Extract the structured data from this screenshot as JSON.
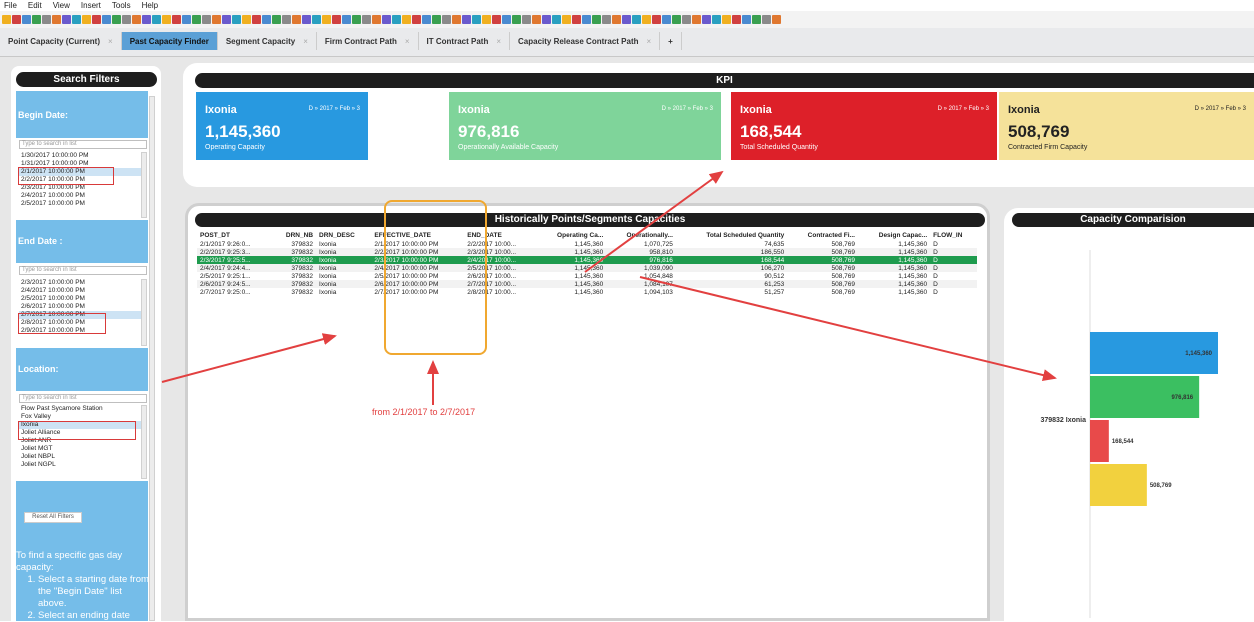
{
  "menu": [
    "File",
    "Edit",
    "View",
    "Insert",
    "Tools",
    "Help"
  ],
  "tabs": [
    {
      "label": "Point Capacity (Current)",
      "active": false
    },
    {
      "label": "Past Capacity Finder",
      "active": true
    },
    {
      "label": "Segment Capacity",
      "active": false
    },
    {
      "label": "Firm Contract Path",
      "active": false
    },
    {
      "label": "IT Contract Path",
      "active": false
    },
    {
      "label": "Capacity Release Contract Path",
      "active": false
    }
  ],
  "tab_close": "×",
  "tab_add": "+",
  "filters": {
    "title": "Search Filters",
    "begin_label": "Begin Date:",
    "end_label": "End Date :",
    "location_label": "Location:",
    "search_placeholder": "Type to search in list",
    "begin_list": [
      "1/30/2017 10:00:00 PM",
      "1/31/2017 10:00:00 PM",
      "2/1/2017 10:00:00 PM",
      "2/2/2017 10:00:00 PM",
      "2/3/2017 10:00:00 PM",
      "2/4/2017 10:00:00 PM",
      "2/5/2017 10:00:00 PM"
    ],
    "end_list": [
      "2/3/2017 10:00:00 PM",
      "2/4/2017 10:00:00 PM",
      "2/5/2017 10:00:00 PM",
      "2/6/2017 10:00:00 PM",
      "2/7/2017 10:00:00 PM",
      "2/8/2017 10:00:00 PM",
      "2/9/2017 10:00:00 PM"
    ],
    "location_list": [
      "Flow Past Sycamore Station",
      "Fox Valley",
      "Ixonia",
      "Joliet Alliance",
      "Joliet ANR",
      "Joliet MGT",
      "Joliet NBPL",
      "Joliet NGPL"
    ],
    "reset_label": "Reset All Filters",
    "instr_intro": "To find a specific gas day capacity:",
    "instr_steps": [
      "Select a starting date from the \"Begin Date\" list above.",
      "Select an ending date"
    ]
  },
  "kpi": {
    "title": "KPI",
    "cards": [
      {
        "loc": "Ixonia",
        "date": "D » 2017 » Feb » 3",
        "value": "1,145,360",
        "label": "Operating Capacity",
        "color": "#2899e0"
      },
      {
        "loc": "Ixonia",
        "date": "D » 2017 » Feb » 3",
        "value": "976,816",
        "label": "Operationally Available Capacity",
        "color": "#7fd49a"
      },
      {
        "loc": "Ixonia",
        "date": "D » 2017 » Feb » 3",
        "value": "168,544",
        "label": "Total Scheduled Quantity",
        "color": "#dd2029"
      },
      {
        "loc": "Ixonia",
        "date": "D » 2017 » Feb » 3",
        "value": "508,769",
        "label": "Contracted Firm Capacity",
        "color": "#f5e29a"
      }
    ]
  },
  "hist": {
    "title": "Historically Points/Segments Capacities",
    "columns": [
      "POST_DT",
      "DRN_NB",
      "DRN_DESC",
      "EFFECTIVE_DATE",
      "END_DATE",
      "Operating Ca...",
      "Operationally...",
      "Total Scheduled Quantity",
      "Contracted Fi...",
      "Design Capac...",
      "FLOW_IN"
    ],
    "rows": [
      [
        "2/1/2017 9:26:0...",
        "379832",
        "Ixonia",
        "2/1/2017 10:00:00 PM",
        "2/2/2017 10:00...",
        "1,145,360",
        "1,070,725",
        "74,635",
        "508,769",
        "1,145,360",
        "D"
      ],
      [
        "2/2/2017 9:25:3...",
        "379832",
        "Ixonia",
        "2/2/2017 10:00:00 PM",
        "2/3/2017 10:00...",
        "1,145,360",
        "958,810",
        "186,550",
        "508,769",
        "1,145,360",
        "D"
      ],
      [
        "2/3/2017 9:25:5...",
        "379832",
        "Ixonia",
        "2/3/2017 10:00:00 PM",
        "2/4/2017 10:00...",
        "1,145,360",
        "976,816",
        "168,544",
        "508,769",
        "1,145,360",
        "D"
      ],
      [
        "2/4/2017 9:24:4...",
        "379832",
        "Ixonia",
        "2/4/2017 10:00:00 PM",
        "2/5/2017 10:00...",
        "1,145,360",
        "1,039,090",
        "106,270",
        "508,769",
        "1,145,360",
        "D"
      ],
      [
        "2/5/2017 9:25:1...",
        "379832",
        "Ixonia",
        "2/5/2017 10:00:00 PM",
        "2/6/2017 10:00...",
        "1,145,360",
        "1,054,848",
        "90,512",
        "508,769",
        "1,145,360",
        "D"
      ],
      [
        "2/6/2017 9:24:5...",
        "379832",
        "Ixonia",
        "2/6/2017 10:00:00 PM",
        "2/7/2017 10:00...",
        "1,145,360",
        "1,084,107",
        "61,253",
        "508,769",
        "1,145,360",
        "D"
      ],
      [
        "2/7/2017 9:25:0...",
        "379832",
        "Ixonia",
        "2/7/2017 10:00:00 PM",
        "2/8/2017 10:00...",
        "1,145,360",
        "1,094,103",
        "51,257",
        "508,769",
        "1,145,360",
        "D"
      ]
    ],
    "annotation": "from 2/1/2017 to 2/7/2017"
  },
  "comparison": {
    "title": "Capacity Comparision",
    "category": "379832 Ixonia"
  },
  "chart_data": {
    "type": "bar",
    "orientation": "horizontal",
    "title": "Capacity Comparision",
    "categories": [
      "379832 Ixonia"
    ],
    "values": [
      1145360,
      976816,
      168544,
      508769
    ],
    "value_labels": [
      "1,145,360",
      "976,816",
      "168,544",
      "508,769"
    ],
    "colors": [
      "#2899e0",
      "#3bbf61",
      "#e84a4a",
      "#f2d13e"
    ],
    "xlim": [
      0,
      1145360
    ]
  }
}
